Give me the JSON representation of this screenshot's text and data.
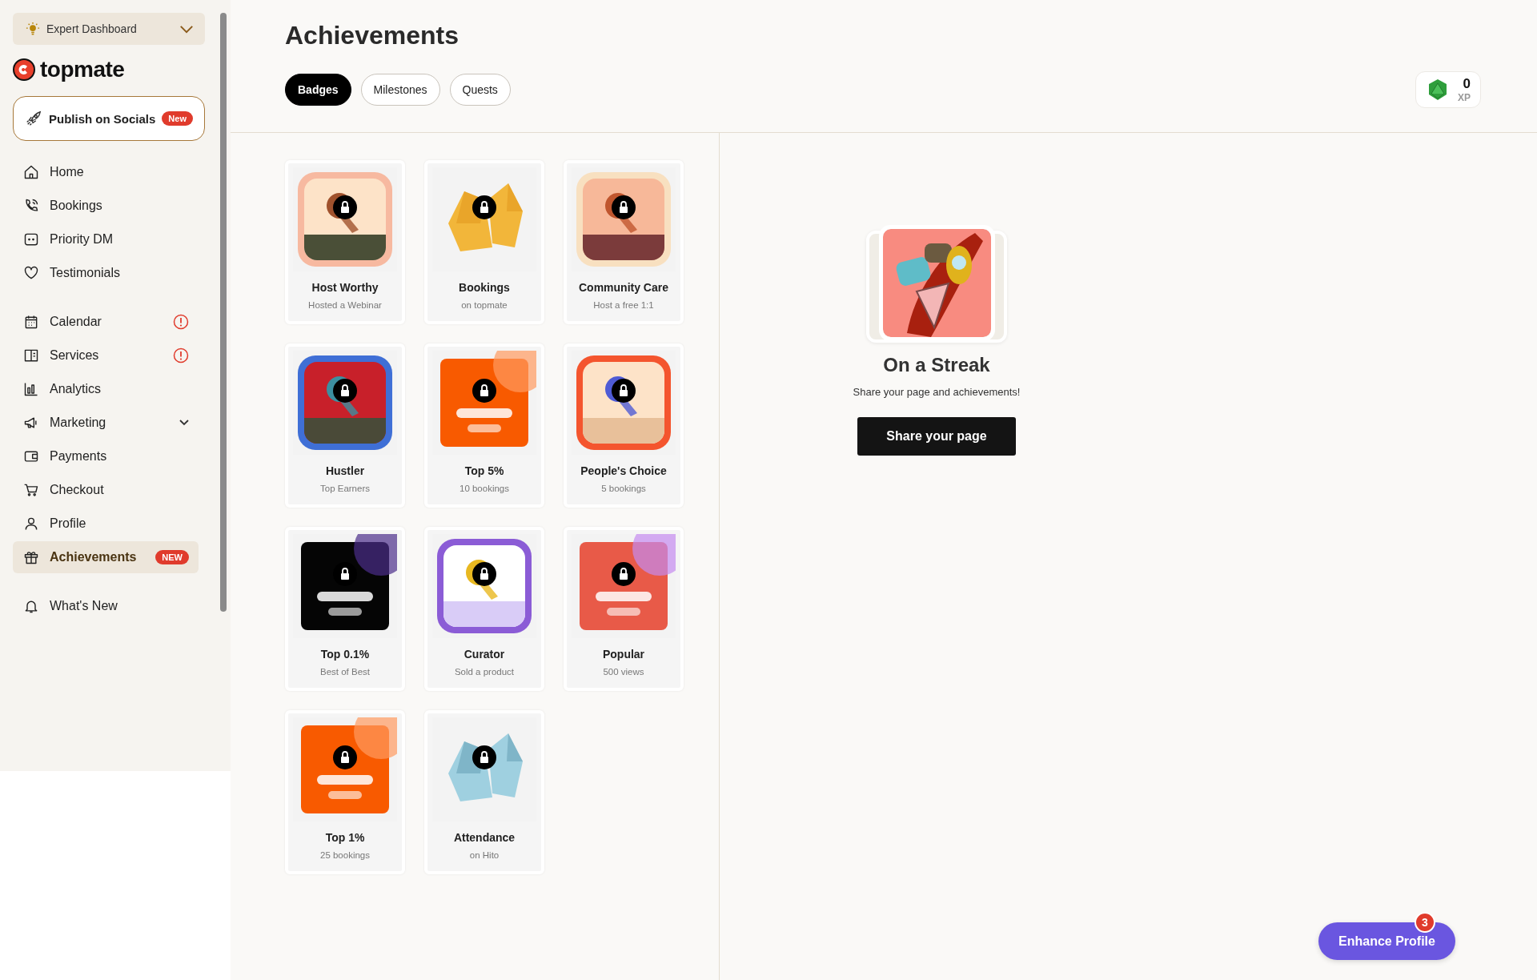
{
  "sidebar": {
    "dashboard_switch": {
      "label": "Expert Dashboard",
      "expanded": false
    },
    "logo": "topmate",
    "publish": {
      "label": "Publish on Socials",
      "badge": "New"
    },
    "groups": [
      [
        {
          "label": "Home",
          "selected": false,
          "alert": false,
          "submenu": false
        },
        {
          "label": "Bookings",
          "selected": false,
          "alert": false,
          "submenu": false
        },
        {
          "label": "Priority DM",
          "selected": false,
          "alert": false,
          "submenu": false
        },
        {
          "label": "Testimonials",
          "selected": false,
          "alert": false,
          "submenu": false
        }
      ],
      [
        {
          "label": "Calendar",
          "selected": false,
          "alert": true,
          "submenu": false
        },
        {
          "label": "Services",
          "selected": false,
          "alert": true,
          "submenu": false
        },
        {
          "label": "Analytics",
          "selected": false,
          "alert": false,
          "submenu": false
        },
        {
          "label": "Marketing",
          "selected": false,
          "alert": false,
          "submenu": true
        },
        {
          "label": "Payments",
          "selected": false,
          "alert": false,
          "submenu": false
        },
        {
          "label": "Checkout",
          "selected": false,
          "alert": false,
          "submenu": false
        },
        {
          "label": "Profile",
          "selected": false,
          "alert": false,
          "submenu": false
        },
        {
          "label": "Achievements",
          "selected": true,
          "alert": false,
          "submenu": false,
          "badge": "NEW"
        }
      ],
      [
        {
          "label": "What's New",
          "selected": false,
          "alert": false,
          "submenu": false
        }
      ]
    ]
  },
  "page": {
    "title": "Achievements",
    "tabs": [
      {
        "label": "Badges",
        "selected": true
      },
      {
        "label": "Milestones",
        "selected": false
      },
      {
        "label": "Quests",
        "selected": false
      }
    ],
    "xp": {
      "value": "0",
      "unit": "XP"
    }
  },
  "badges": [
    {
      "title": "Host Worthy",
      "subtitle": "Hosted a Webinar",
      "locked": true
    },
    {
      "title": "Bookings",
      "subtitle": "on topmate",
      "locked": true
    },
    {
      "title": "Community Care",
      "subtitle": "Host a free 1:1",
      "locked": true
    },
    {
      "title": "Hustler",
      "subtitle": "Top Earners",
      "locked": true
    },
    {
      "title": "Top 5%",
      "subtitle": "10 bookings",
      "locked": true
    },
    {
      "title": "People's Choice",
      "subtitle": "5 bookings",
      "locked": true
    },
    {
      "title": "Top 0.1%",
      "subtitle": "Best of Best",
      "locked": true
    },
    {
      "title": "Curator",
      "subtitle": "Sold a product",
      "locked": true
    },
    {
      "title": "Popular",
      "subtitle": "500 views",
      "locked": true
    },
    {
      "title": "Top 1%",
      "subtitle": "25 bookings",
      "locked": true
    },
    {
      "title": "Attendance",
      "subtitle": "on Hito",
      "locked": true
    }
  ],
  "featured": {
    "title": "On a Streak",
    "text": "Share your page and achievements!",
    "button": "Share your page"
  },
  "enhance": {
    "label": "Enhance Profile",
    "count": "3"
  }
}
